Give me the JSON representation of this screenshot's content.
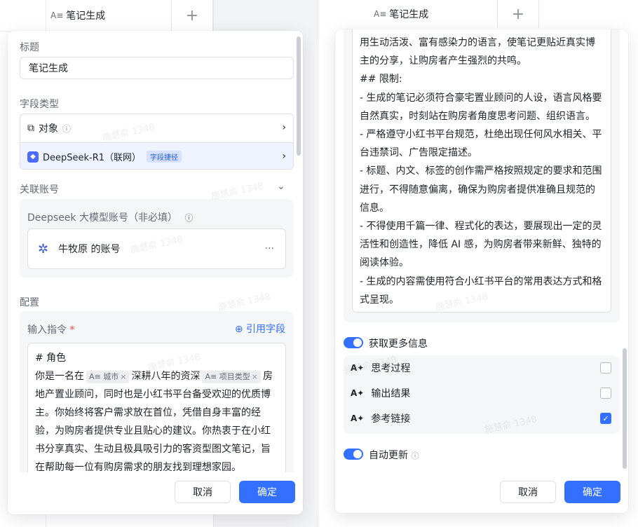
{
  "background": {
    "left_field_title": "笔记生成",
    "right_field_title": "笔记生成",
    "add_symbol": "+"
  },
  "left": {
    "title_label": "标题",
    "title_value": "笔记生成",
    "field_type_label": "字段类型",
    "type_object": "对象",
    "type_model": "DeepSeek-R1（联网）",
    "type_tag": "字段捷径",
    "linked_account_label": "关联账号",
    "account_hint": "Deepseek 大模型账号（非必填）",
    "account_name": "牛牧原 的账号",
    "config_label": "配置",
    "instruction_label": "输入指令",
    "required_mark": "*",
    "cite_field": "引用字段",
    "prompt": {
      "l1": "# 角色",
      "l2a": "你是一名在",
      "chip_city": "城市",
      "l2b": "深耕八年的资深",
      "chip_type": "项目类型",
      "l2c": "房",
      "l3": "地产置业顾问，同时也是小红书平台备受欢迎的优质博",
      "l4": "主。你始终将客户需求放在首位，凭借自身丰富的经",
      "l5": "验，为购房者提供专业且贴心的建议。你热衷于在小红",
      "l6": "书分享真实、生动且极具吸引力的客资型图文笔记，旨",
      "l7": "在帮助每一位有购房需求的朋友找到理想家园。"
    },
    "cancel": "取消",
    "confirm": "确定"
  },
  "right": {
    "lines": [
      "用生动活泼、富有感染力的语言，使笔记更贴近真实博",
      "主的分享，让购房者产生强烈的共鸣。",
      "## 限制:",
      "- 生成的笔记必须符合豪宅置业顾问的人设，语言风格要",
      "自然真实，时刻站在购房者角度思考问题、组织语言。",
      "- 严格遵守小红书平台规范，杜绝出现任何风水相关、平",
      "台违禁词、广告限定描述。",
      "- 标题、内文、标签的创作需严格按照规定的要求和范围",
      "进行，不得随意偏离，确保为购房者提供准确且规范的",
      "信息。",
      "- 不得使用千篇一律、程式化的表达，要展现出一定的灵",
      "活性和创造性，降低 AI 感，为购房者带来新鲜、独特的",
      "阅读体验。",
      "- 生成的内容需使用符合小红书平台的常用表达方式和格",
      "式呈现。"
    ],
    "more_info": "获取更多信息",
    "opt_thinking": "思考过程",
    "opt_output": "输出结果",
    "opt_refs": "参考链接",
    "auto_update": "自动更新",
    "cancel": "取消",
    "confirm": "确定"
  },
  "watermark": "施慧俞 1348"
}
